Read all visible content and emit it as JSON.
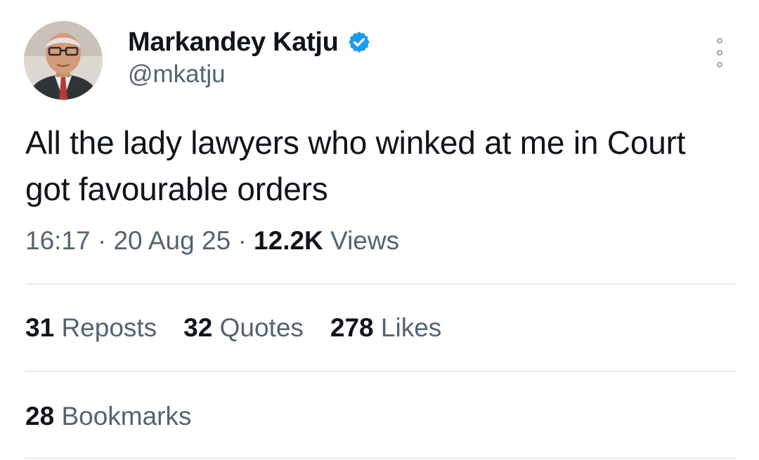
{
  "author": {
    "display_name": "Markandey Katju",
    "handle": "@mkatju",
    "verified": true,
    "verified_color": "#1d9bf0"
  },
  "tweet": {
    "text": "All the lady lawyers who winked at me in Court got favourable orders",
    "time": "16:17",
    "date": "20 Aug 25",
    "separator": "·",
    "views_count": "12.2K",
    "views_label": "Views"
  },
  "stats": {
    "reposts_count": "31",
    "reposts_label": "Reposts",
    "quotes_count": "32",
    "quotes_label": "Quotes",
    "likes_count": "278",
    "likes_label": "Likes",
    "bookmarks_count": "28",
    "bookmarks_label": "Bookmarks"
  },
  "icons": {
    "verified": "verified-badge-icon",
    "more": "more-options-icon"
  },
  "colors": {
    "text_primary": "#0f1419",
    "text_secondary": "#536471",
    "divider": "#cfd9de"
  }
}
